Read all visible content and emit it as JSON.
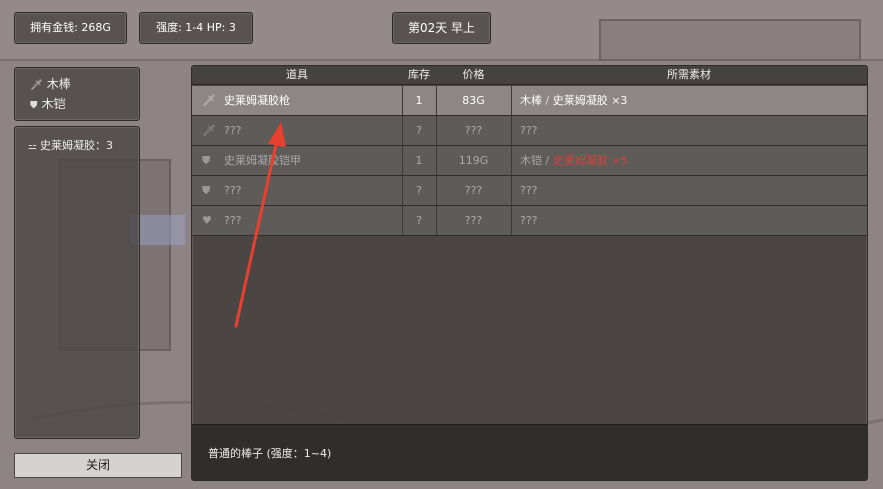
{
  "hud": {
    "money": "拥有金钱: 268G",
    "stats": "强度: 1-4 HP: 3",
    "day": "第02天 早上"
  },
  "equipment": [
    {
      "icon": "sword-icon",
      "label": "木棒"
    },
    {
      "icon": "shield-icon",
      "label": "木铠"
    }
  ],
  "materials": [
    {
      "icon": "bone-icon",
      "label": "史莱姆凝胶：3"
    }
  ],
  "shop": {
    "headers": {
      "item": "道具",
      "stock": "库存",
      "price": "价格",
      "materials": "所需素材"
    },
    "rows": [
      {
        "icon": "sword-icon",
        "name": "史莱姆凝胶枪",
        "stock": "1",
        "price": "83G",
        "mat_a": "木棒",
        "mat_sep": " / ",
        "mat_b": "史莱姆凝胶 ×3",
        "state": "selected"
      },
      {
        "icon": "sword-icon",
        "name": "???",
        "stock": "?",
        "price": "???",
        "mat_a": "???",
        "mat_sep": "",
        "mat_b": "",
        "state": "unknown"
      },
      {
        "icon": "shield-icon",
        "name": "史莱姆凝胶铠甲",
        "stock": "1",
        "price": "119G",
        "mat_a": "木铠",
        "mat_sep": " / ",
        "mat_b": "史莱姆凝胶 ×5",
        "state": "insufficient"
      },
      {
        "icon": "shield-icon",
        "name": "???",
        "stock": "?",
        "price": "???",
        "mat_a": "???",
        "mat_sep": "",
        "mat_b": "",
        "state": "unknown"
      },
      {
        "icon": "heart-icon",
        "name": "???",
        "stock": "?",
        "price": "???",
        "mat_a": "???",
        "mat_sep": "",
        "mat_b": "",
        "state": "unknown"
      }
    ],
    "description": "普通的棒子 (强度：1~4)"
  },
  "close_label": "关闭",
  "colors": {
    "accent_red": "#d8413b",
    "selected_row": "#8c8784",
    "annotation_arrow": "#e8402f"
  }
}
